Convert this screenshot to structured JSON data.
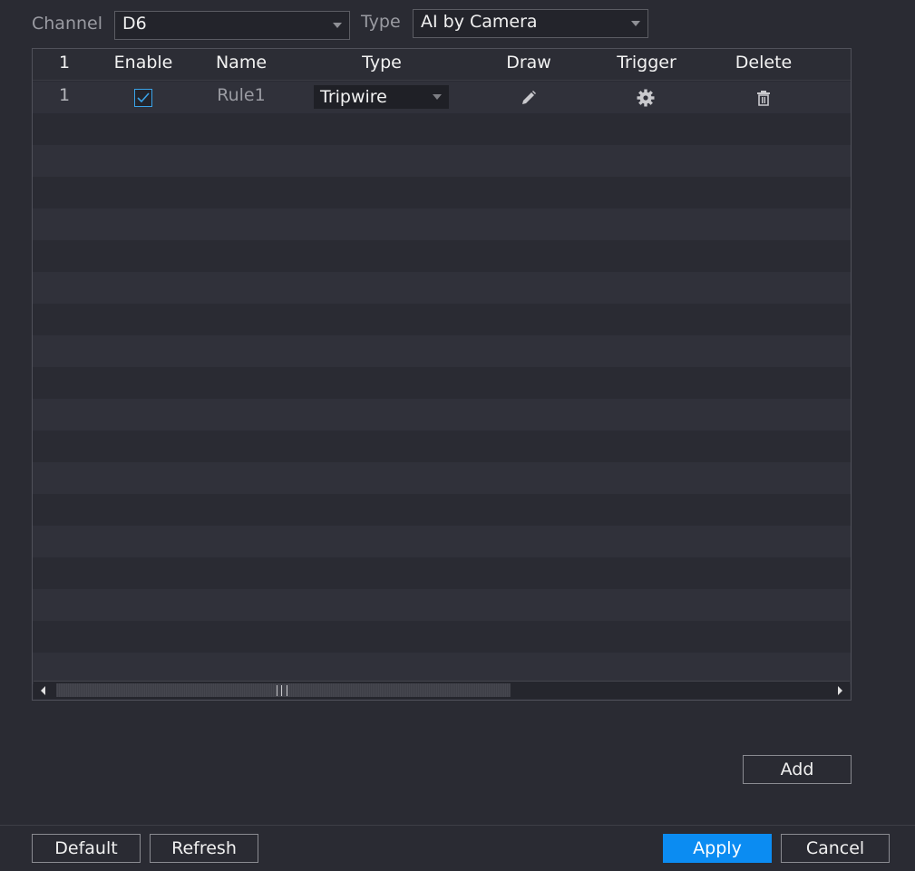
{
  "filters": {
    "channel_label": "Channel",
    "channel_value": "D6",
    "type_label": "Type",
    "type_value": "AI by Camera"
  },
  "table": {
    "columns": [
      "1",
      "Enable",
      "Name",
      "Type",
      "Draw",
      "Trigger",
      "Delete"
    ],
    "rows": [
      {
        "index": "1",
        "enabled": true,
        "name": "Rule1",
        "type": "Tripwire",
        "draw_icon": "pencil-icon",
        "trigger_icon": "gear-icon",
        "delete_icon": "trash-icon"
      }
    ]
  },
  "buttons": {
    "add": "Add",
    "default": "Default",
    "refresh": "Refresh",
    "apply": "Apply",
    "cancel": "Cancel"
  },
  "colors": {
    "background": "#2a2b33",
    "accent": "#0b8cf2",
    "checkbox": "#3aa3e8"
  }
}
